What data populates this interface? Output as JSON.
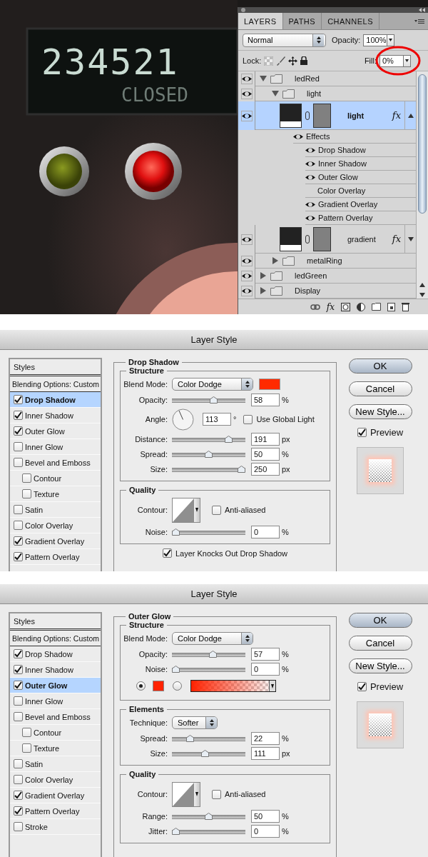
{
  "artwork": {
    "display_number": "234521",
    "display_status": "CLOSED"
  },
  "layers_panel": {
    "tabs": [
      {
        "label": "LAYERS",
        "selected": true
      },
      {
        "label": "PATHS",
        "selected": false
      },
      {
        "label": "CHANNELS",
        "selected": false
      }
    ],
    "blend_mode": "Normal",
    "opacity_label": "Opacity:",
    "opacity": "100%",
    "lock_label": "Lock:",
    "fill_label": "Fill:",
    "fill": "0%",
    "fill_circled": true,
    "layers": [
      {
        "name": "ledRed",
        "kind": "group",
        "visible": true,
        "expanded": true,
        "selected": false,
        "children": [
          {
            "name": "light",
            "kind": "group",
            "visible": true,
            "expanded": true,
            "selected": false,
            "children": [
              {
                "name": "light",
                "kind": "layer",
                "visible": true,
                "selected": true,
                "fx": "fx",
                "effects_expanded": true,
                "effects": {
                  "label": "Effects",
                  "visible": true,
                  "items": [
                    {
                      "label": "Drop Shadow",
                      "visible": true
                    },
                    {
                      "label": "Inner Shadow",
                      "visible": true
                    },
                    {
                      "label": "Outer Glow",
                      "visible": true
                    },
                    {
                      "label": "Color Overlay",
                      "visible": false
                    },
                    {
                      "label": "Gradient Overlay",
                      "visible": true
                    },
                    {
                      "label": "Pattern Overlay",
                      "visible": true
                    }
                  ]
                }
              },
              {
                "name": "gradient",
                "kind": "layer",
                "visible": true,
                "selected": false,
                "fx": "fx",
                "effects_expanded": false
              }
            ]
          },
          {
            "name": "metalRing",
            "kind": "group",
            "visible": true,
            "expanded": false,
            "selected": false
          }
        ]
      },
      {
        "name": "ledGreen",
        "kind": "group",
        "visible": true,
        "expanded": false,
        "selected": false
      },
      {
        "name": "Display",
        "kind": "group",
        "visible": true,
        "expanded": false,
        "selected": false
      }
    ],
    "toolbar_fx": "fx"
  },
  "dialogs": [
    {
      "title": "Layer Style",
      "styles_header": "Styles",
      "styles": [
        {
          "label": "Blending Options: Custom",
          "kind": "option",
          "selected": false
        },
        {
          "label": "Drop Shadow",
          "kind": "checkbox",
          "checked": true,
          "selected": true
        },
        {
          "label": "Inner Shadow",
          "kind": "checkbox",
          "checked": true,
          "selected": false
        },
        {
          "label": "Outer Glow",
          "kind": "checkbox",
          "checked": true,
          "selected": false
        },
        {
          "label": "Inner Glow",
          "kind": "checkbox",
          "checked": false,
          "selected": false
        },
        {
          "label": "Bevel and Emboss",
          "kind": "checkbox",
          "checked": false,
          "selected": false,
          "children": [
            {
              "label": "Contour",
              "kind": "checkbox",
              "checked": false,
              "selected": false
            },
            {
              "label": "Texture",
              "kind": "checkbox",
              "checked": false,
              "selected": false
            }
          ]
        },
        {
          "label": "Satin",
          "kind": "checkbox",
          "checked": false,
          "selected": false
        },
        {
          "label": "Color Overlay",
          "kind": "checkbox",
          "checked": false,
          "selected": false
        },
        {
          "label": "Gradient Overlay",
          "kind": "checkbox",
          "checked": true,
          "selected": false
        },
        {
          "label": "Pattern Overlay",
          "kind": "checkbox",
          "checked": true,
          "selected": false
        }
      ],
      "section_title": "Drop Shadow",
      "groups": [
        {
          "title": "Structure",
          "rows": [
            {
              "kind": "select",
              "label": "Blend Mode:",
              "value": "Color Dodge",
              "color": "#ff2a00"
            },
            {
              "kind": "slider",
              "label": "Opacity:",
              "level": 0.58,
              "value": "58",
              "unit": "%"
            },
            {
              "kind": "angle",
              "label": "Angle:",
              "value": "113",
              "unit": "°",
              "checkbox": {
                "label": "Use Global Light",
                "checked": false
              }
            },
            {
              "kind": "slider",
              "label": "Distance:",
              "level": 0.8,
              "value": "191",
              "unit": "px"
            },
            {
              "kind": "slider",
              "label": "Spread:",
              "level": 0.5,
              "value": "50",
              "unit": "%"
            },
            {
              "kind": "slider",
              "label": "Size:",
              "level": 1,
              "value": "250",
              "unit": "px"
            }
          ]
        },
        {
          "title": "Quality",
          "rows": [
            {
              "kind": "contour",
              "label": "Contour:",
              "checkbox": {
                "label": "Anti-aliased",
                "checked": false
              }
            },
            {
              "kind": "slider",
              "label": "Noise:",
              "level": 0,
              "value": "0",
              "unit": "%"
            }
          ]
        }
      ],
      "footer_checkbox": {
        "label": "Layer Knocks Out Drop Shadow",
        "checked": true
      },
      "buttons": [
        {
          "label": "OK",
          "default": true
        },
        {
          "label": "Cancel",
          "default": false
        },
        {
          "label": "New Style...",
          "default": false
        }
      ],
      "preview": {
        "label": "Preview",
        "checked": true
      }
    },
    {
      "title": "Layer Style",
      "styles_header": "Styles",
      "styles": [
        {
          "label": "Blending Options: Custom",
          "kind": "option",
          "selected": false
        },
        {
          "label": "Drop Shadow",
          "kind": "checkbox",
          "checked": true,
          "selected": false
        },
        {
          "label": "Inner Shadow",
          "kind": "checkbox",
          "checked": true,
          "selected": false
        },
        {
          "label": "Outer Glow",
          "kind": "checkbox",
          "checked": true,
          "selected": true
        },
        {
          "label": "Inner Glow",
          "kind": "checkbox",
          "checked": false,
          "selected": false
        },
        {
          "label": "Bevel and Emboss",
          "kind": "checkbox",
          "checked": false,
          "selected": false,
          "children": [
            {
              "label": "Contour",
              "kind": "checkbox",
              "checked": false,
              "selected": false
            },
            {
              "label": "Texture",
              "kind": "checkbox",
              "checked": false,
              "selected": false
            }
          ]
        },
        {
          "label": "Satin",
          "kind": "checkbox",
          "checked": false,
          "selected": false
        },
        {
          "label": "Color Overlay",
          "kind": "checkbox",
          "checked": false,
          "selected": false
        },
        {
          "label": "Gradient Overlay",
          "kind": "checkbox",
          "checked": true,
          "selected": false
        },
        {
          "label": "Pattern Overlay",
          "kind": "checkbox",
          "checked": true,
          "selected": false
        },
        {
          "label": "Stroke",
          "kind": "checkbox",
          "checked": false,
          "selected": false
        }
      ],
      "section_title": "Outer Glow",
      "groups": [
        {
          "title": "Structure",
          "rows": [
            {
              "kind": "select",
              "label": "Blend Mode:",
              "value": "Color Dodge"
            },
            {
              "kind": "slider",
              "label": "Opacity:",
              "level": 0.57,
              "value": "57",
              "unit": "%"
            },
            {
              "kind": "slider",
              "label": "Noise:",
              "level": 0,
              "value": "0",
              "unit": "%"
            },
            {
              "kind": "color_choice",
              "options": [
                {
                  "kind": "color",
                  "selected": true,
                  "color": "#ff2200"
                },
                {
                  "kind": "gradient",
                  "selected": false
                }
              ]
            }
          ]
        },
        {
          "title": "Elements",
          "rows": [
            {
              "kind": "select",
              "label": "Technique:",
              "value": "Softer"
            },
            {
              "kind": "slider",
              "label": "Spread:",
              "level": 0.22,
              "value": "22",
              "unit": "%"
            },
            {
              "kind": "slider",
              "label": "Size:",
              "level": 0.45,
              "value": "111",
              "unit": "px"
            }
          ]
        },
        {
          "title": "Quality",
          "rows": [
            {
              "kind": "contour",
              "label": "Contour:",
              "checkbox": {
                "label": "Anti-aliased",
                "checked": false
              }
            },
            {
              "kind": "slider",
              "label": "Range:",
              "level": 0.5,
              "value": "50",
              "unit": "%"
            },
            {
              "kind": "slider",
              "label": "Jitter:",
              "level": 0,
              "value": "0",
              "unit": "%"
            }
          ]
        }
      ],
      "buttons": [
        {
          "label": "OK",
          "default": true
        },
        {
          "label": "Cancel",
          "default": false
        },
        {
          "label": "New Style...",
          "default": false
        }
      ],
      "preview": {
        "label": "Preview",
        "checked": true
      }
    }
  ]
}
